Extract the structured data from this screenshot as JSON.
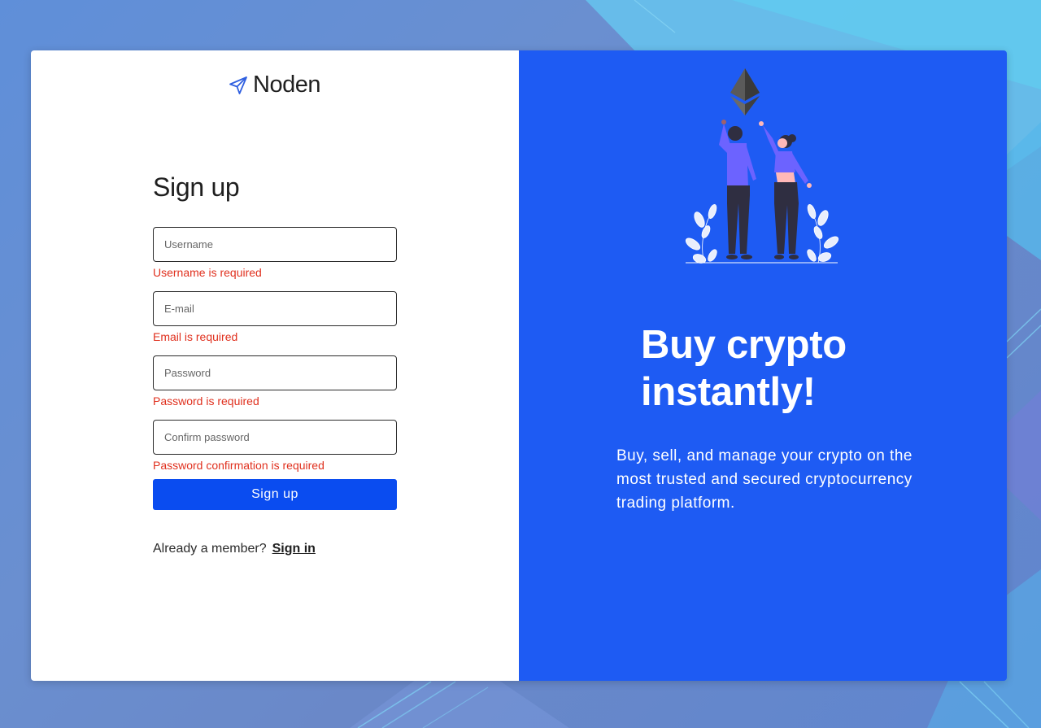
{
  "brand": {
    "name": "Noden",
    "icon": "paper-plane-icon"
  },
  "signup": {
    "title": "Sign up",
    "fields": [
      {
        "placeholder": "Username",
        "value": "",
        "error": "Username is required"
      },
      {
        "placeholder": "E-mail",
        "value": "",
        "error": "Email is required"
      },
      {
        "placeholder": "Password",
        "value": "",
        "error": "Password is required"
      },
      {
        "placeholder": "Confirm password",
        "value": "",
        "error": "Password confirmation is required"
      }
    ],
    "submit_label": "Sign up",
    "member_text": "Already a member?",
    "signin_label": "Sign in"
  },
  "promo": {
    "headline_line1": "Buy crypto",
    "headline_line2": "instantly!",
    "description": "Buy, sell, and manage your crypto on the most trusted and secured cryptocurrency trading platform.",
    "illustration": "crypto-celebration-illustration"
  },
  "colors": {
    "accent": "#1e5bf3",
    "button": "#0a4cf0",
    "error": "#e0301e",
    "figure_purple": "#6c63ff"
  }
}
